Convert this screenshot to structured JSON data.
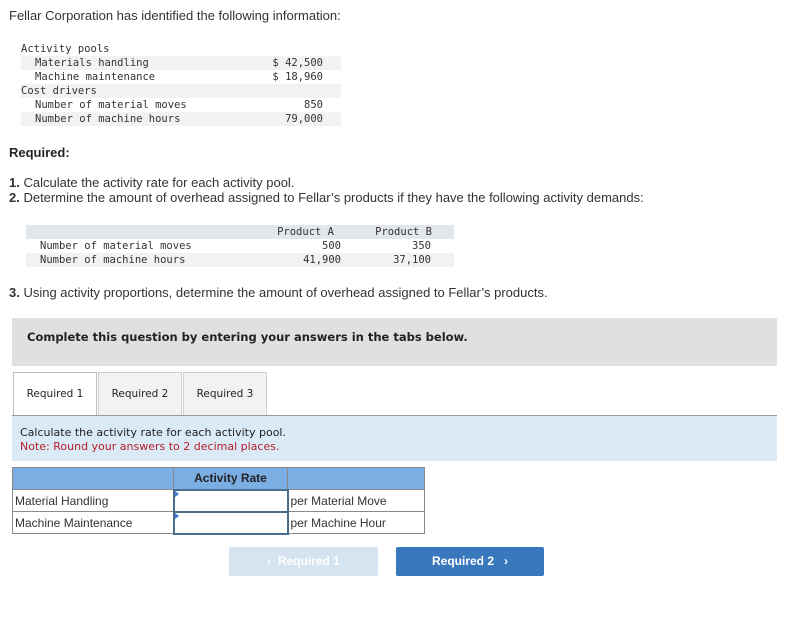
{
  "intro": "Fellar Corporation has identified the following information:",
  "info_table": {
    "activity_pools_label": "Activity pools",
    "pools": [
      {
        "label": "Materials handling",
        "value": "$ 42,500"
      },
      {
        "label": "Machine maintenance",
        "value": "$ 18,960"
      }
    ],
    "cost_drivers_label": "Cost drivers",
    "drivers": [
      {
        "label": "Number of material moves",
        "value": "850"
      },
      {
        "label": "Number of machine hours",
        "value": "79,000"
      }
    ]
  },
  "required": {
    "title": "Required:",
    "items": [
      {
        "num": "1.",
        "text": " Calculate the activity rate for each activity pool."
      },
      {
        "num": "2.",
        "text": " Determine the amount of overhead assigned to Fellar’s products if they have the following activity demands:"
      }
    ],
    "item3": {
      "num": "3.",
      "text": " Using activity proportions, determine the amount of overhead assigned to Fellar’s products."
    }
  },
  "demand_table": {
    "headers": [
      "Product A",
      "Product B"
    ],
    "rows": [
      {
        "label": "Number of material moves",
        "a": "500",
        "b": "350"
      },
      {
        "label": "Number of machine hours",
        "a": "41,900",
        "b": "37,100"
      }
    ]
  },
  "banner": "Complete this question by entering your answers in the tabs below.",
  "tabs": [
    {
      "label": "Required 1",
      "active": true
    },
    {
      "label": "Required 2",
      "active": false
    },
    {
      "label": "Required 3",
      "active": false
    }
  ],
  "instructions": {
    "line1": "Calculate the activity rate for each activity pool.",
    "note": "Note: Round your answers to 2 decimal places."
  },
  "answer_table": {
    "header": "Activity Rate",
    "rows": [
      {
        "label": "Material Handling",
        "value": "",
        "unit": "per Material Move"
      },
      {
        "label": "Machine Maintenance",
        "value": "",
        "unit": "per Machine Hour"
      }
    ]
  },
  "nav": {
    "prev_label": "Required 1",
    "next_label": "Required 2",
    "prev_icon": "chevron-left-icon",
    "next_icon": "chevron-right-icon"
  }
}
